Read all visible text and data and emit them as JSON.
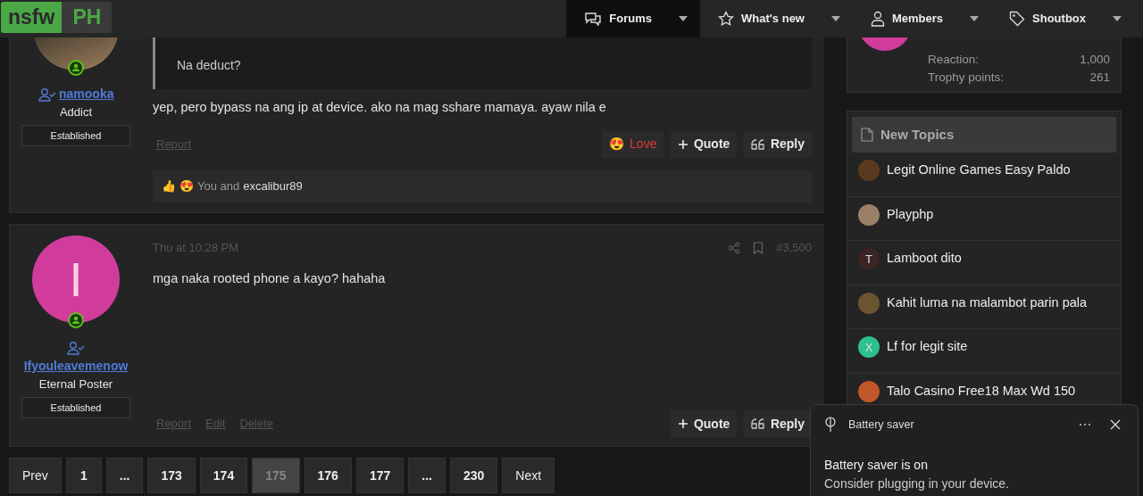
{
  "header": {
    "logo": {
      "part_1": "nsfw",
      "part_2": "PH"
    },
    "nav": [
      {
        "label": "Forums",
        "selected": true
      },
      {
        "label": "What's new",
        "selected": false
      },
      {
        "label": "Members",
        "selected": false
      },
      {
        "label": "Shoutbox",
        "selected": false
      }
    ]
  },
  "posts": [
    {
      "author": {
        "name": "namooka",
        "title": "Addict",
        "banner": "Established",
        "online": true,
        "avatar": {
          "kind": "photo"
        }
      },
      "quote": {
        "text": "Na deduct?"
      },
      "message": "yep, pero bypass na ang ip at device. ako na mag sshare mamaya. ayaw nila e",
      "links": [
        "Report"
      ],
      "buttons": [
        {
          "kind": "love",
          "emoji": "😍",
          "label": "Love"
        },
        {
          "kind": "quote",
          "label": "Quote"
        },
        {
          "kind": "reply",
          "label": "Reply"
        }
      ],
      "reactions": {
        "emojis": [
          "👍",
          "😍"
        ],
        "text": "You and",
        "user": "excalibur89"
      }
    },
    {
      "author": {
        "name": "Ifyouleavemenow",
        "title": "Eternal Poster",
        "banner": "Established",
        "online": true,
        "avatar": {
          "kind": "letter",
          "letter": "I",
          "color": "#d13c9c"
        }
      },
      "date": "Thu at 10:28 PM",
      "number": "#3,500",
      "message": "mga naka rooted phone a kayo? hahaha",
      "links": [
        "Report",
        "Edit",
        "Delete"
      ],
      "buttons": [
        {
          "kind": "quote",
          "label": "Quote"
        },
        {
          "kind": "reply",
          "label": "Reply"
        }
      ]
    }
  ],
  "pagination": [
    {
      "label": "Prev",
      "selected": false
    },
    {
      "label": "1",
      "selected": false
    },
    {
      "label": "...",
      "selected": false
    },
    {
      "label": "173",
      "selected": false
    },
    {
      "label": "174",
      "selected": false
    },
    {
      "label": "175",
      "selected": true
    },
    {
      "label": "176",
      "selected": false
    },
    {
      "label": "177",
      "selected": false
    },
    {
      "label": "...",
      "selected": false
    },
    {
      "label": "230",
      "selected": false
    },
    {
      "label": "Next",
      "selected": false
    }
  ],
  "sidebar": {
    "member_stats": [
      {
        "label": "Reaction:",
        "value": "1,000"
      },
      {
        "label": "Trophy points:",
        "value": "261"
      }
    ],
    "new_topics": {
      "title": "New Topics",
      "items": [
        {
          "title": "Legit Online Games Easy Paldo",
          "avatar": {
            "kind": "photo",
            "color": "#5a3a1e"
          }
        },
        {
          "title": "Playphp",
          "avatar": {
            "kind": "photo",
            "color": "#9a8066"
          }
        },
        {
          "title": "Lamboot dito",
          "avatar": {
            "kind": "letter",
            "letter": "T",
            "color": "#3d2424"
          }
        },
        {
          "title": "Kahit luma na malambot parin pala",
          "avatar": {
            "kind": "photo",
            "color": "#6b5530"
          }
        },
        {
          "title": "Lf for legit site",
          "avatar": {
            "kind": "letter",
            "letter": "X",
            "color": "#2fc08f"
          }
        },
        {
          "title": "Talo Casino Free18 Max Wd 150",
          "avatar": {
            "kind": "photo",
            "color": "#c0562a"
          }
        }
      ]
    }
  },
  "toast": {
    "app": "Battery saver",
    "title": "Battery saver is on",
    "body": "Consider plugging in your device."
  }
}
